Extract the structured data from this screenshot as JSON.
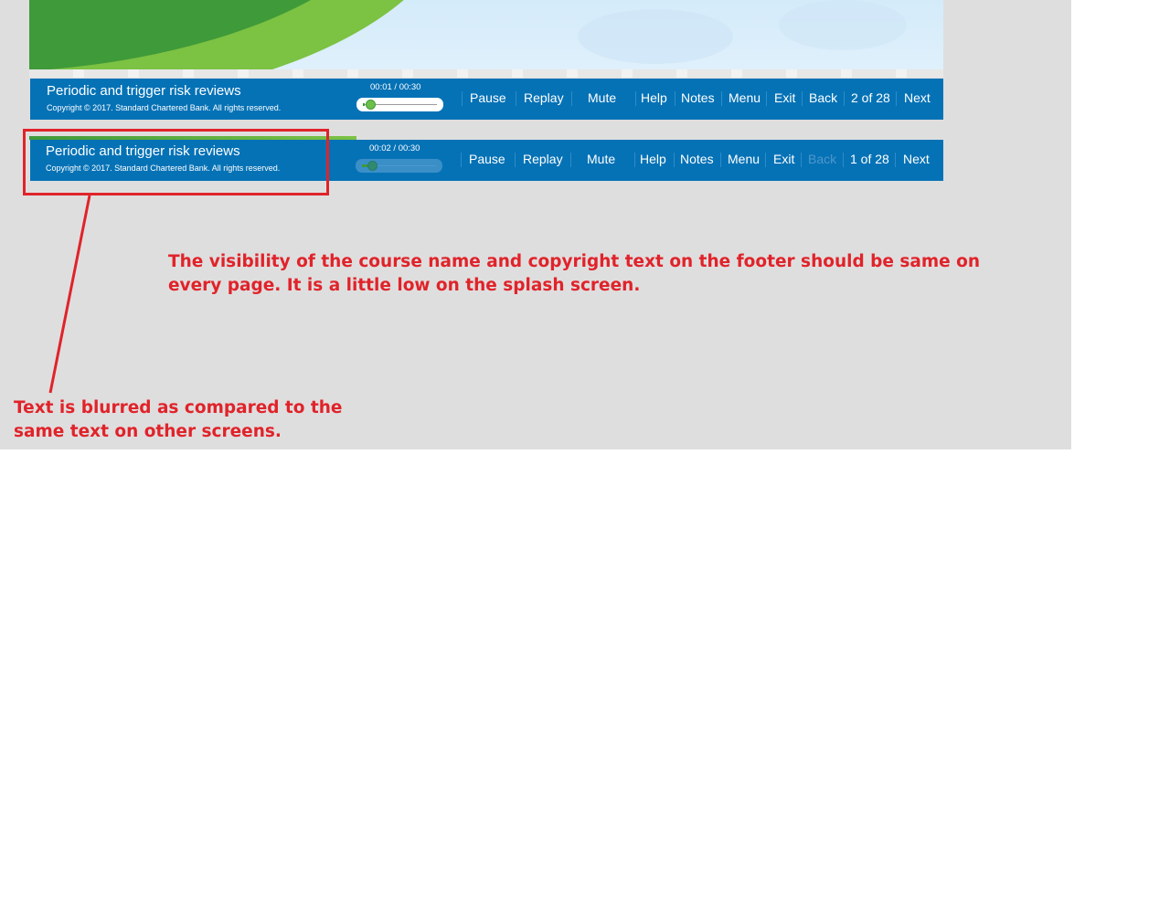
{
  "footer_before": {
    "course_title": "Periodic and trigger risk reviews",
    "copyright": "Copyright © 2017. Standard Chartered Bank. All rights reserved.",
    "time": "00:01 / 00:30",
    "progress": 0.03,
    "controls": {
      "pause": "Pause",
      "replay": "Replay",
      "mute": "Mute",
      "help": "Help",
      "notes": "Notes",
      "menu": "Menu",
      "exit": "Exit",
      "back": "Back",
      "page_indicator": "2 of 28",
      "next": "Next"
    }
  },
  "footer_after": {
    "course_title": "Periodic and trigger risk reviews",
    "copyright": "Copyright © 2017. Standard Chartered Bank. All rights reserved.",
    "time": "00:02 / 00:30",
    "progress": 0.07,
    "controls": {
      "pause": "Pause",
      "replay": "Replay",
      "mute": "Mute",
      "help": "Help",
      "notes": "Notes",
      "menu": "Menu",
      "exit": "Exit",
      "back": "Back",
      "back_state": "disabled",
      "page_indicator": "1 of 28",
      "next": "Next"
    }
  },
  "annotations": {
    "visibility_note": "The visibility of the course name and copyright text on the footer should be same on every page. It is a little low on the splash screen.",
    "blur_note": "Text is blurred as compared to the same text on other screens."
  },
  "colors": {
    "footer_bg": "#0572b6",
    "annotation_red": "#e0232a",
    "brand_green_dark": "#3f9a39",
    "brand_green_light": "#7cc243",
    "canvas_gray": "#dfdede"
  }
}
